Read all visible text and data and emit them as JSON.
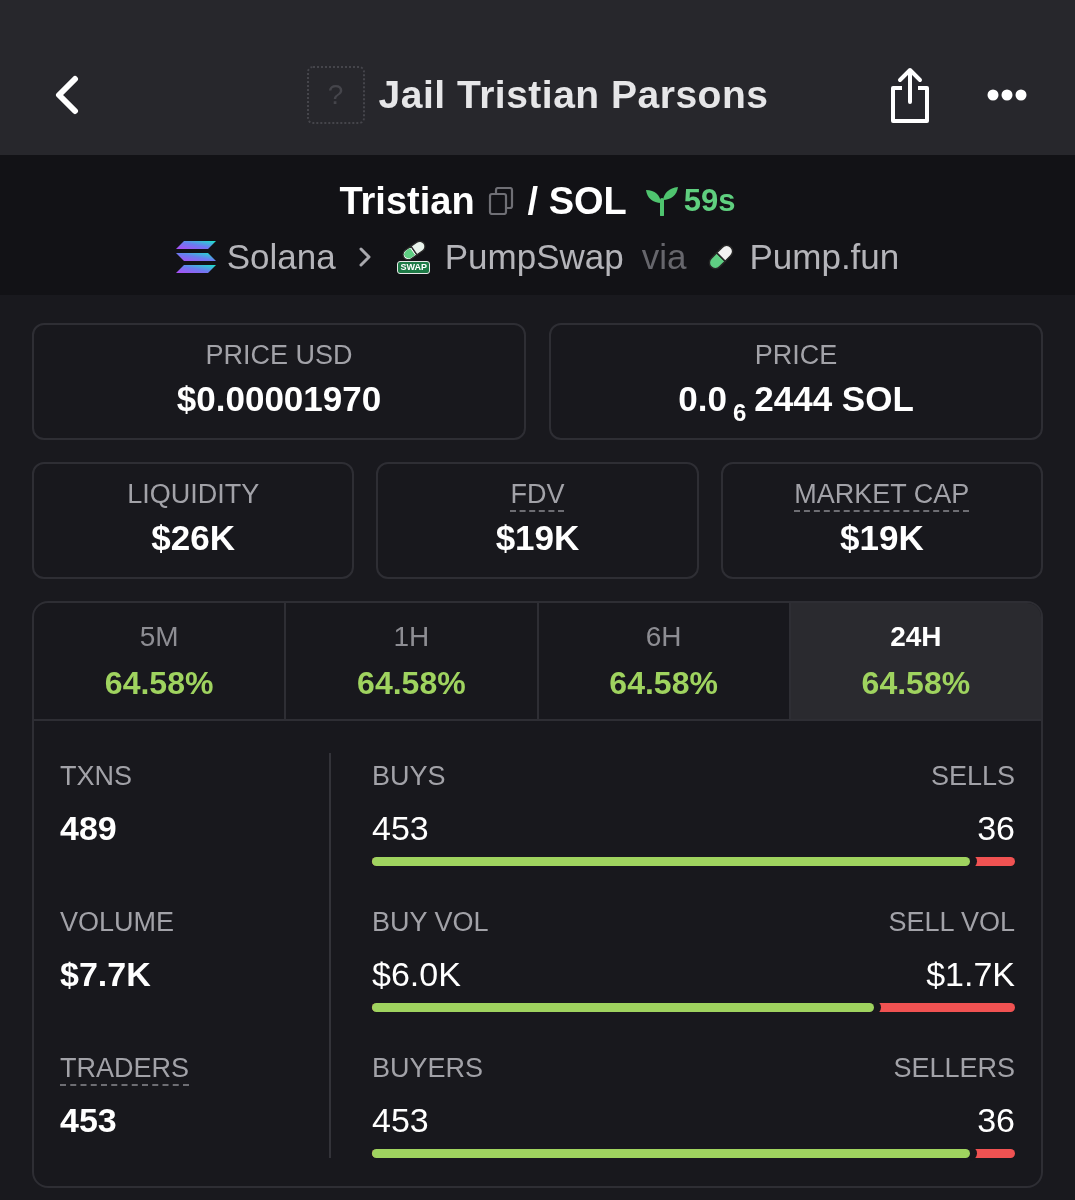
{
  "header": {
    "token_image": {
      "glyph": "?"
    },
    "title": "Jail Tristian Parsons"
  },
  "pair": {
    "base": "Tristian",
    "quote": "/ SOL",
    "age": "59s",
    "chain": "Solana",
    "dex": "PumpSwap",
    "dex_badge": "SWAP",
    "via": "via",
    "launchpad": "Pump.fun"
  },
  "price_cards": [
    {
      "label": "PRICE USD",
      "value": "$0.00001970",
      "underlined": false
    },
    {
      "label": "PRICE",
      "value": "0.0$_{6}$2444 SOL",
      "underlined": false
    }
  ],
  "metric_cards": [
    {
      "label": "LIQUIDITY",
      "value": "$26K",
      "underlined": false
    },
    {
      "label": "FDV",
      "value": "$19K",
      "underlined": true
    },
    {
      "label": "MARKET CAP",
      "value": "$19K",
      "underlined": true
    }
  ],
  "tabs": [
    {
      "label": "5M",
      "change": "64.58%",
      "selected": false
    },
    {
      "label": "1H",
      "change": "64.58%",
      "selected": false
    },
    {
      "label": "6H",
      "change": "64.58%",
      "selected": false
    },
    {
      "label": "24H",
      "change": "64.58%",
      "selected": true
    }
  ],
  "stats": {
    "totals": [
      {
        "label": "TXNS",
        "value": "489",
        "underlined": false
      },
      {
        "label": "VOLUME",
        "value": "$7.7K",
        "underlined": false
      },
      {
        "label": "TRADERS",
        "value": "453",
        "underlined": true
      }
    ],
    "splits": [
      {
        "left_label": "BUYS",
        "left_value": "453",
        "right_label": "SELLS",
        "right_value": "36",
        "level": 0.93
      },
      {
        "left_label": "BUY VOL",
        "left_value": "$6.0K",
        "right_label": "SELL VOL",
        "right_value": "$1.7K",
        "level": 0.78
      },
      {
        "left_label": "BUYERS",
        "left_value": "453",
        "right_label": "SELLERS",
        "right_value": "36",
        "level": 0.93
      }
    ]
  }
}
